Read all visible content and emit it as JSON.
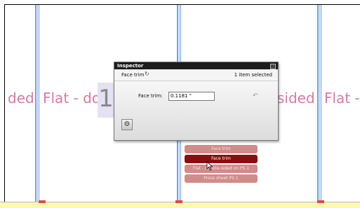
{
  "sheet": {
    "fragments": [
      "ded",
      "Flat - dou",
      "sided",
      "Flat -"
    ],
    "big_digit": "1"
  },
  "inspector": {
    "title": "Inspector",
    "section_label": "Face trim",
    "selection_status": "1 item selected",
    "field_label": "Face trim:",
    "field_value": "0.1181 \""
  },
  "context_menu": {
    "items": [
      "Face trim",
      "Face trim",
      "Flat - double-sided on PS 1",
      "Press sheet PS 1"
    ],
    "active_index": 1
  },
  "colors": {
    "accent_red": "#8b0d0d",
    "menu_pink": "#d08b8b",
    "sheet_text": "#d77aa3",
    "guide_blue": "#6fa0e0",
    "bottom_yellow": "#fff9b0"
  }
}
